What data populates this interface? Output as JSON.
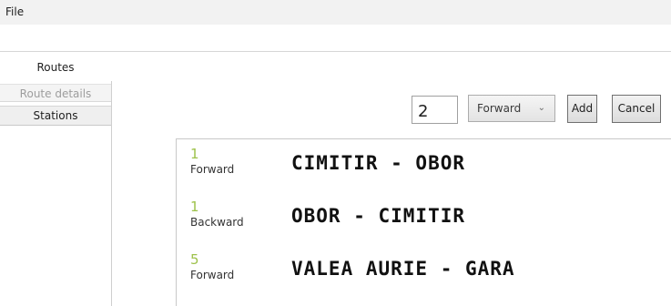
{
  "menu": {
    "file_label": "File"
  },
  "tabs": [
    {
      "label": "Routes"
    },
    {
      "label": "Route details"
    },
    {
      "label": "Stations"
    }
  ],
  "controls": {
    "number_value": "2",
    "direction_selected": "Forward",
    "add_label": "Add",
    "cancel_label": "Cancel"
  },
  "routes": [
    {
      "number": "1",
      "direction": "Forward",
      "name": "CIMITIR - OBOR"
    },
    {
      "number": "1",
      "direction": "Backward",
      "name": "OBOR - CIMITIR"
    },
    {
      "number": "5",
      "direction": "Forward",
      "name": "VALEA AURIE - GARA"
    }
  ],
  "colors": {
    "route_number": "#9ec24b",
    "disabled_text": "#9d9d9d"
  },
  "icons": {
    "dropdown": "chevron-down-icon"
  }
}
